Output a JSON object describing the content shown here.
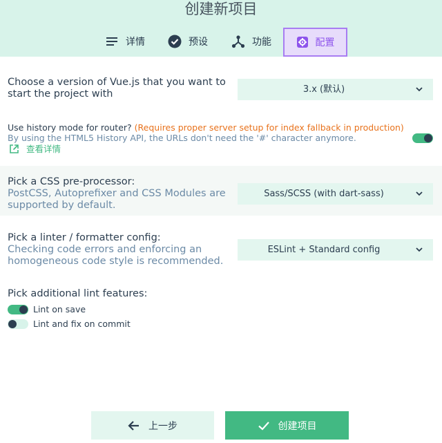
{
  "header": {
    "title": "创建新项目",
    "tabs": [
      {
        "label": "详情",
        "icon": "list-icon"
      },
      {
        "label": "预设",
        "icon": "check-circle-icon"
      },
      {
        "label": "功能",
        "icon": "fork-icon"
      },
      {
        "label": "配置",
        "icon": "gear-icon",
        "active": true
      }
    ]
  },
  "vue_version": {
    "prompt_line1": "Choose a version of Vue.js that you want to",
    "prompt_line2": "start the project with",
    "value": "3.x (默认)"
  },
  "history_mode": {
    "prompt": "Use history mode for router?",
    "warning": "(Requires proper server setup for index fallback in production)",
    "description": "By using the HTML5 History API, the URLs don't need the '#' character anymore.",
    "link": "查看详情",
    "enabled": true
  },
  "css_preprocessor": {
    "prompt": "Pick a CSS pre-processor:",
    "desc_line1": "PostCSS, Autoprefixer and CSS Modules are",
    "desc_line2": "supported by default.",
    "value": "Sass/SCSS (with dart-sass)"
  },
  "linter": {
    "prompt": "Pick a linter / formatter config:",
    "desc_line1": "Checking code errors and enforcing an",
    "desc_line2": "homogeneous code style is recommended.",
    "value": "ESLint + Standard config"
  },
  "lint_features": {
    "prompt": "Pick additional lint features:",
    "options": [
      {
        "label": "Lint on save",
        "enabled": true
      },
      {
        "label": "Lint and fix on commit",
        "enabled": false
      }
    ]
  },
  "footer": {
    "back_label": "上一步",
    "create_label": "创建项目"
  },
  "colors": {
    "accent": "#42b983",
    "header_bg": "#d8f3ea",
    "active_tab": "#8e54ec",
    "warning": "#e8721c"
  }
}
